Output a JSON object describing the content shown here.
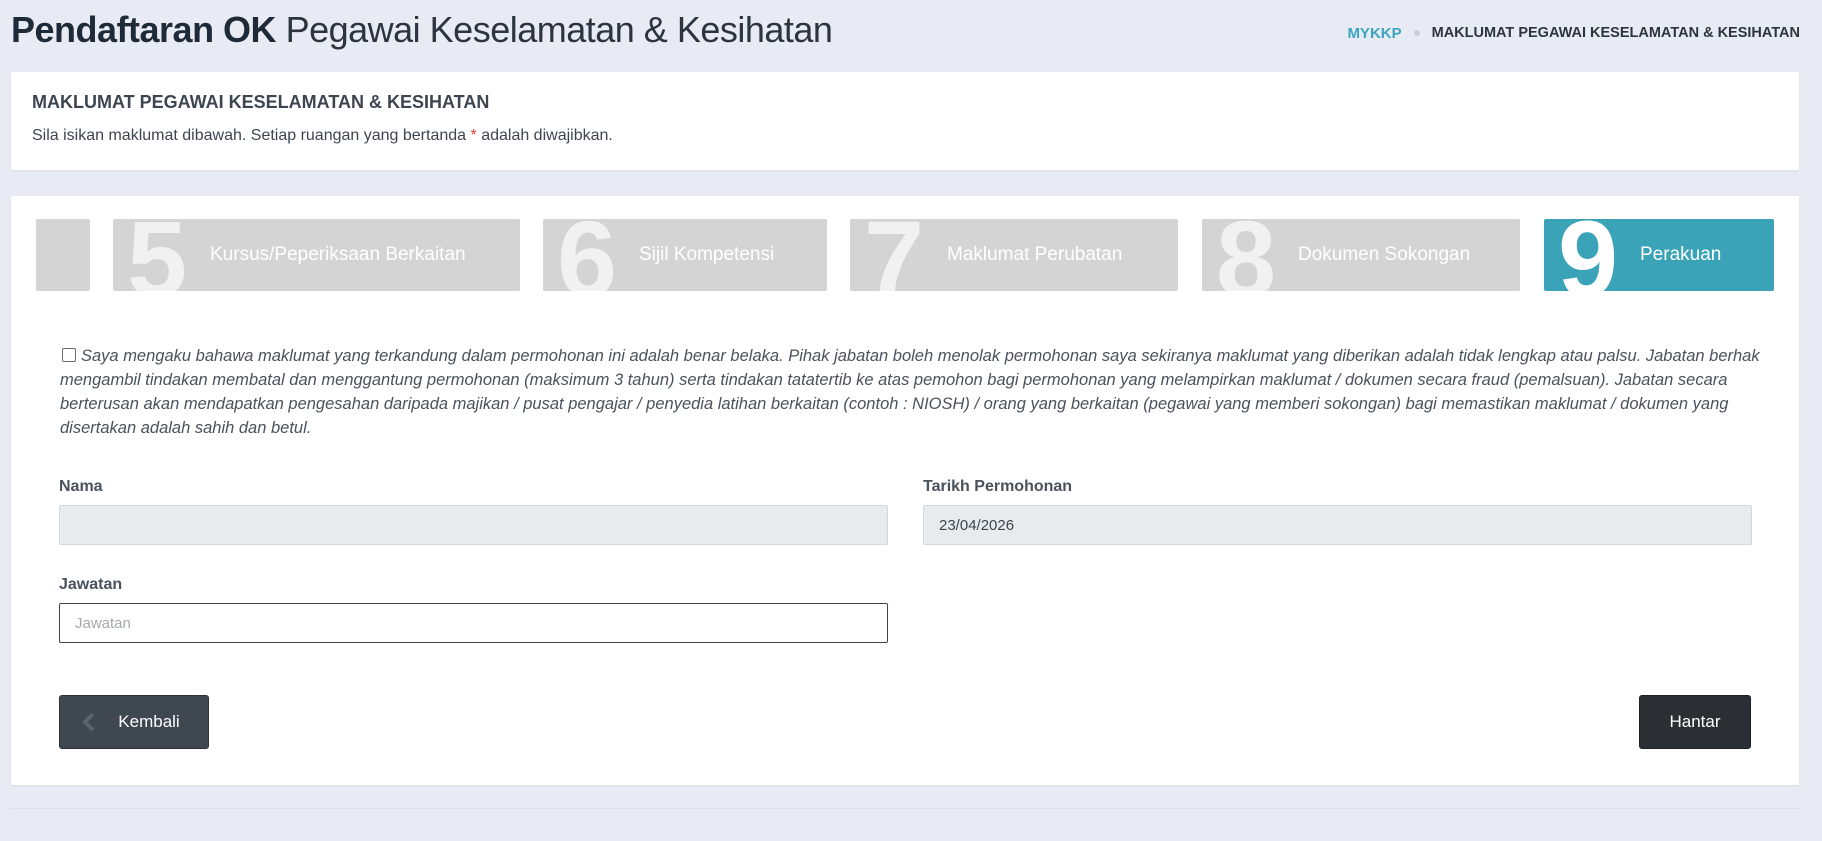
{
  "header": {
    "title_bold": "Pendaftaran OK",
    "title_light": "Pegawai Keselamatan & Kesihatan",
    "breadcrumb": {
      "home": "MYKKP",
      "current": "MAKLUMAT PEGAWAI KESELAMATAN & KESIHATAN"
    }
  },
  "info": {
    "title": "MAKLUMAT PEGAWAI KESELAMATAN & KESIHATAN",
    "text_before": "Sila isikan maklumat dibawah. Setiap ruangan yang bertanda",
    "required_mark": "*",
    "text_after": "adalah diwajibkan."
  },
  "steps": [
    {
      "number": "",
      "label": ""
    },
    {
      "number": "5",
      "label": "Kursus/Peperiksaan Berkaitan"
    },
    {
      "number": "6",
      "label": "Sijil Kompetensi"
    },
    {
      "number": "7",
      "label": "Maklumat Perubatan"
    },
    {
      "number": "8",
      "label": "Dokumen Sokongan"
    },
    {
      "number": "9",
      "label": "Perakuan",
      "active": true
    }
  ],
  "declaration": {
    "checked": false,
    "text": "Saya mengaku bahawa maklumat yang terkandung dalam permohonan ini adalah benar belaka. Pihak jabatan boleh menolak permohonan saya sekiranya maklumat yang diberikan adalah tidak lengkap atau palsu. Jabatan berhak mengambil tindakan membatal dan menggantung permohonan (maksimum 3 tahun) serta tindakan tatatertib ke atas pemohon bagi permohonan yang melampirkan maklumat / dokumen secara fraud (pemalsuan). Jabatan secara berterusan akan mendapatkan pengesahan daripada majikan / pusat pengajar / penyedia latihan berkaitan (contoh : NIOSH) / orang yang berkaitan (pegawai yang memberi sokongan) bagi memastikan maklumat / dokumen yang disertakan adalah sahih dan betul."
  },
  "form": {
    "nama": {
      "label": "Nama",
      "value": ""
    },
    "tarikh": {
      "label": "Tarikh Permohonan",
      "value": "23/04/2026"
    },
    "jawatan": {
      "label": "Jawatan",
      "placeholder": "Jawatan",
      "value": ""
    }
  },
  "buttons": {
    "back": "Kembali",
    "submit": "Hantar"
  },
  "colors": {
    "accent": "#3aa3b8",
    "step_inactive": "#d4d4d4",
    "required": "#e0443a",
    "button_dark": "#2b2f34"
  }
}
